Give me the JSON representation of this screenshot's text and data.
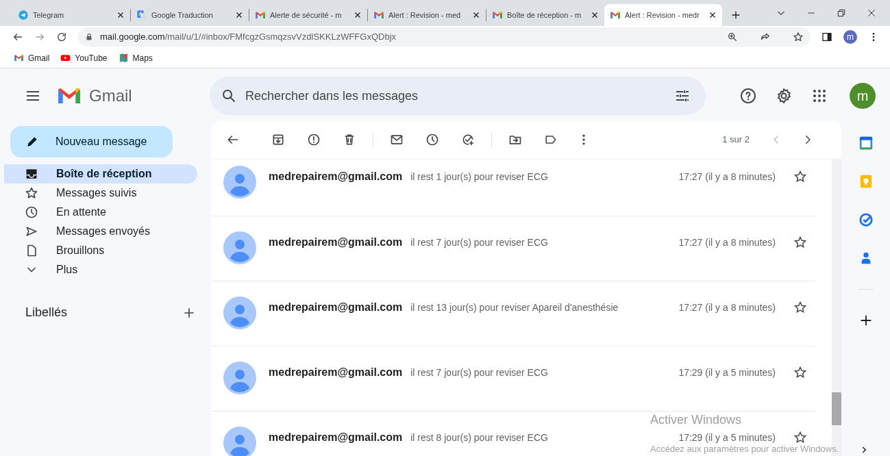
{
  "browser": {
    "tabs": [
      {
        "title": "Telegram",
        "kind": "telegram",
        "selected": false
      },
      {
        "title": "Google Traduction",
        "kind": "translate",
        "selected": false
      },
      {
        "title": "Alerte de sécurité - m",
        "kind": "gmail",
        "selected": false
      },
      {
        "title": "Alert : Revision - med",
        "kind": "gmail",
        "selected": false
      },
      {
        "title": "Boîte de réception - m",
        "kind": "gmail",
        "selected": false
      },
      {
        "title": "Alert : Revision - medr",
        "kind": "gmail",
        "selected": true
      }
    ],
    "address": {
      "host": "mail.google.com",
      "path": "/mail/u/1/#inbox/FMfcgzGsmqzsvVzdlSKKLzWFFGxQDbjx"
    },
    "profile_initial": "m",
    "bookmarks": [
      {
        "label": "Gmail",
        "kind": "gmail"
      },
      {
        "label": "YouTube",
        "kind": "youtube"
      },
      {
        "label": "Maps",
        "kind": "maps"
      }
    ]
  },
  "gmail": {
    "logo_text": "Gmail",
    "search": {
      "placeholder": "Rechercher dans les messages"
    },
    "account_initial": "m",
    "compose": "Nouveau message",
    "nav": [
      {
        "label": "Boîte de réception",
        "selected": true
      },
      {
        "label": "Messages suivis",
        "selected": false
      },
      {
        "label": "En attente",
        "selected": false
      },
      {
        "label": "Messages envoyés",
        "selected": false
      },
      {
        "label": "Brouillons",
        "selected": false
      },
      {
        "label": "Plus",
        "selected": false
      }
    ],
    "labels_heading": "Libellés",
    "pagination": "1 sur 2",
    "messages": [
      {
        "sender": "medrepairem@gmail.com",
        "subject": "il rest 1 jour(s) pour reviser ECG",
        "time": "17:27 (il y a 8 minutes)",
        "starred": false
      },
      {
        "sender": "medrepairem@gmail.com",
        "subject": "il rest 7 jour(s) pour reviser ECG",
        "time": "17:27 (il y a 8 minutes)",
        "starred": false
      },
      {
        "sender": "medrepairem@gmail.com",
        "subject": "il rest 13 jour(s) pour reviser Apareil d'anesthésie",
        "time": "17:27 (il y a 8 minutes)",
        "starred": false
      },
      {
        "sender": "medrepairem@gmail.com",
        "subject": "il rest 7 jour(s) pour reviser ECG",
        "time": "17:29 (il y a 5 minutes)",
        "starred": false
      },
      {
        "sender": "medrepairem@gmail.com",
        "subject": "il rest 8 jour(s) pour reviser ECG",
        "time": "17:29 (il y a 5 minutes)",
        "starred": false
      }
    ]
  },
  "windows_notice": {
    "title": "Activer Windows",
    "text": "Accédez aux paramètres pour activer Windows."
  }
}
